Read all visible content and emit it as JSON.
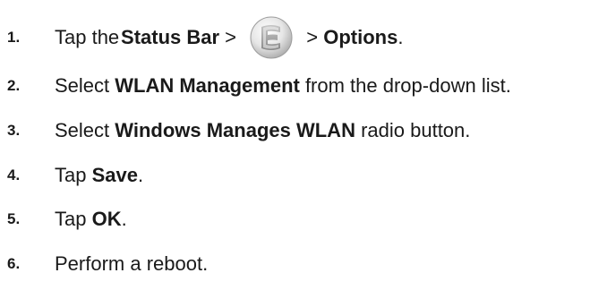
{
  "steps": [
    {
      "number": "1.",
      "parts": [
        "Tap the ",
        "Status Bar",
        " > ",
        " > ",
        "Options",
        "."
      ],
      "icon": "start-menu-logo-icon"
    },
    {
      "number": "2.",
      "parts": [
        "Select ",
        "WLAN Management",
        " from the drop-down list."
      ]
    },
    {
      "number": "3.",
      "parts": [
        "Select ",
        "Windows Manages WLAN",
        " radio button."
      ]
    },
    {
      "number": "4.",
      "parts": [
        "Tap ",
        "Save",
        "."
      ]
    },
    {
      "number": "5.",
      "parts": [
        "Tap ",
        "OK",
        "."
      ]
    },
    {
      "number": "6.",
      "parts": [
        "Perform a reboot."
      ]
    }
  ],
  "colors": {
    "text": "#1a1a1a",
    "icon_light": "#e9e9e9",
    "icon_dark": "#9a9a9a"
  }
}
